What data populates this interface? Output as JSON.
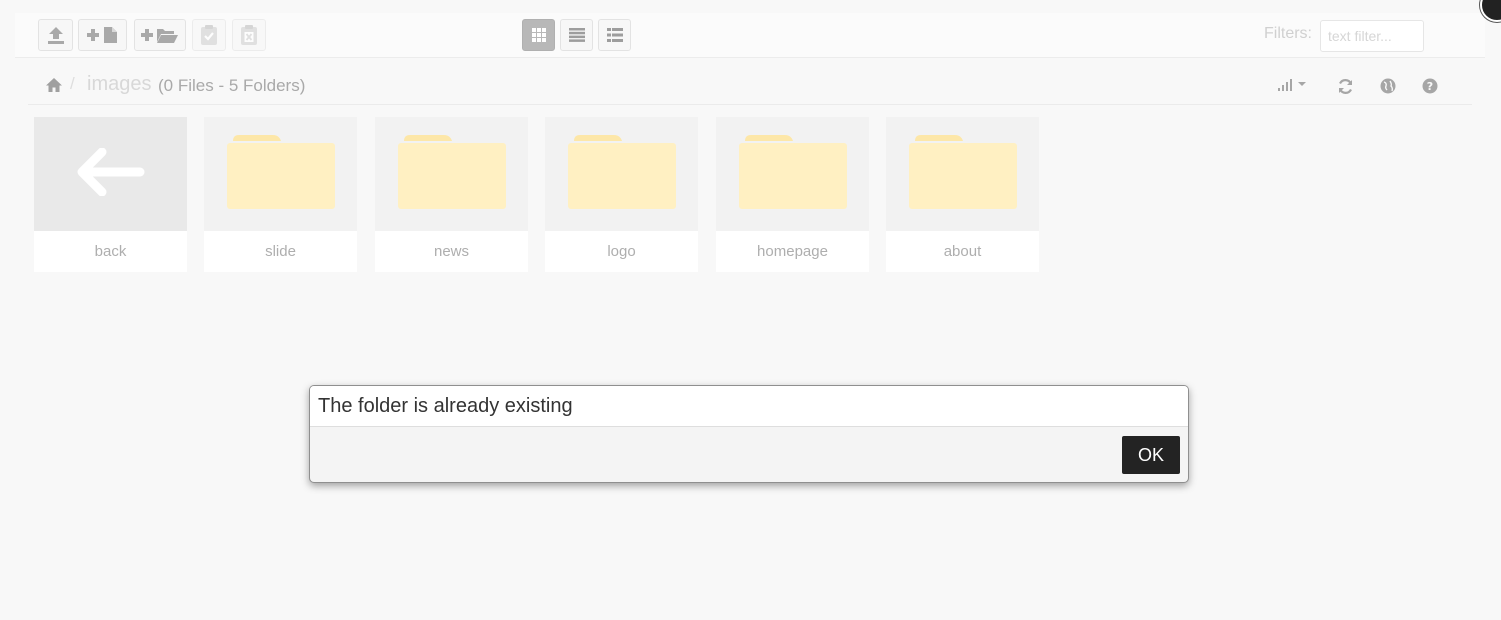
{
  "toolbar": {
    "buttons": [
      {
        "name": "upload-button",
        "icon": "upload-icon"
      },
      {
        "name": "new-file-button",
        "icon": "new-file-icon"
      },
      {
        "name": "new-folder-button",
        "icon": "new-folder-icon"
      },
      {
        "name": "paste-button",
        "icon": "clipboard-check-icon",
        "disabled": true
      },
      {
        "name": "clear-clipboard-button",
        "icon": "clipboard-clear-icon",
        "disabled": true
      }
    ],
    "views": [
      {
        "name": "grid-view-button",
        "icon": "grid-icon",
        "active": true
      },
      {
        "name": "list-view-button",
        "icon": "list-icon",
        "active": false
      },
      {
        "name": "columns-view-button",
        "icon": "columns-icon",
        "active": false
      }
    ],
    "filters_label": "Filters:",
    "filter_placeholder": "text filter..."
  },
  "breadcrumb": {
    "separator": "/",
    "current_folder": "images",
    "summary": "(0 Files - 5 Folders)"
  },
  "items": [
    {
      "label": "back",
      "type": "back"
    },
    {
      "label": "slide",
      "type": "folder"
    },
    {
      "label": "news",
      "type": "folder"
    },
    {
      "label": "logo",
      "type": "folder"
    },
    {
      "label": "homepage",
      "type": "folder"
    },
    {
      "label": "about",
      "type": "folder"
    }
  ],
  "dialog": {
    "message": "The folder is already existing",
    "ok_label": "OK"
  },
  "colors": {
    "folder": "#fff0c2",
    "folder_tab": "#fde7a8",
    "dialog_button": "#232323"
  }
}
